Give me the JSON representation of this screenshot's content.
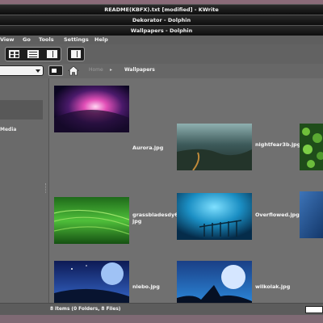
{
  "windows": {
    "title_1": "README(KBFX).txt [modified] - KWrite",
    "title_2": "Dekorator - Dolphin",
    "title_3": "Wallpapers - Dolphin"
  },
  "menu": {
    "view": "View",
    "go": "Go",
    "tools": "Tools",
    "settings": "Settings",
    "help": "Help"
  },
  "toolbar": {
    "icons": [
      "icons-view-icon",
      "details-view-icon",
      "columns-view-icon",
      "split-view-icon"
    ]
  },
  "location": {
    "combo_value": "",
    "breadcrumb_home": "Home",
    "breadcrumb_separator": "▸",
    "breadcrumb_current": "Wallpapers"
  },
  "sidebar": {
    "label_media": "Media"
  },
  "files": [
    {
      "name": "Aurora.jpg"
    },
    {
      "name": "nightfear3b.jpg"
    },
    {
      "name": ""
    },
    {
      "name": "grassbladesdy6.jpg"
    },
    {
      "name": "Overflowed.jpg"
    },
    {
      "name": ""
    },
    {
      "name": "niebo.jpg"
    },
    {
      "name": "wilkolak.jpg"
    }
  ],
  "status": {
    "text": "8 Items (0 Folders, 8 Files)"
  },
  "colors": {
    "titlebar": "#111111",
    "window_bg": "#6e6e6e",
    "content_bg": "#707070",
    "text": "#f5f5f5"
  }
}
